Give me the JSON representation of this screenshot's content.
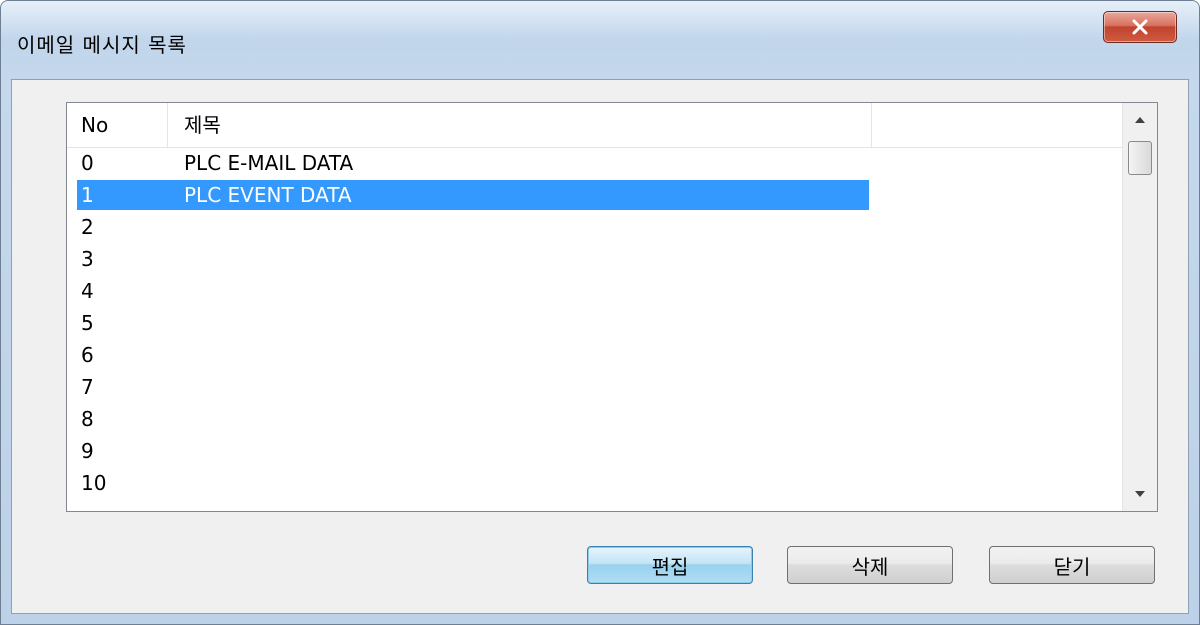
{
  "window": {
    "title": "이메일 메시지 목록",
    "close_label": "X"
  },
  "list": {
    "columns": [
      "No",
      "제목"
    ],
    "rows": [
      {
        "no": "0",
        "subject": "PLC E-MAIL DATA",
        "selected": false
      },
      {
        "no": "1",
        "subject": "PLC EVENT DATA",
        "selected": true
      },
      {
        "no": "2",
        "subject": "",
        "selected": false
      },
      {
        "no": "3",
        "subject": "",
        "selected": false
      },
      {
        "no": "4",
        "subject": "",
        "selected": false
      },
      {
        "no": "5",
        "subject": "",
        "selected": false
      },
      {
        "no": "6",
        "subject": "",
        "selected": false
      },
      {
        "no": "7",
        "subject": "",
        "selected": false
      },
      {
        "no": "8",
        "subject": "",
        "selected": false
      },
      {
        "no": "9",
        "subject": "",
        "selected": false
      },
      {
        "no": "10",
        "subject": "",
        "selected": false
      }
    ],
    "selection_color": "#3399ff"
  },
  "buttons": {
    "edit": "편집",
    "delete": "삭제",
    "close": "닫기"
  }
}
